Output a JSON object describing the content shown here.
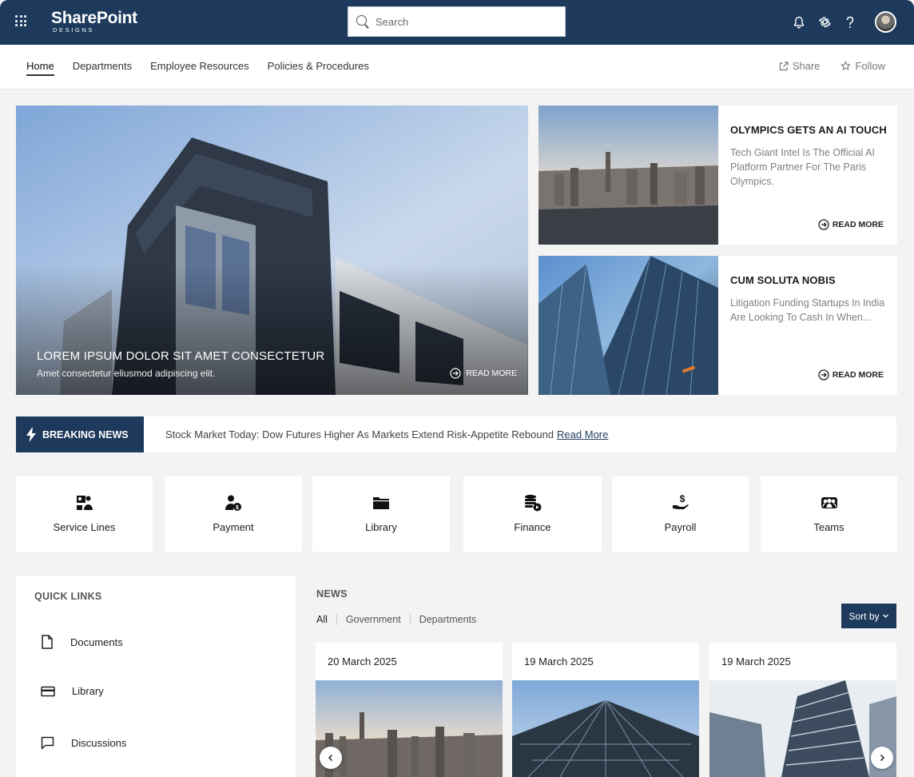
{
  "app": {
    "logo_main": "SharePoint",
    "logo_sub": "DESIGNS",
    "search_placeholder": "Search"
  },
  "nav": {
    "items": [
      "Home",
      "Departments",
      "Employee Resources",
      "Policies & Procedures"
    ],
    "active": "Home",
    "share_label": "Share",
    "follow_label": "Follow"
  },
  "hero": {
    "title": "LOREM IPSUM DOLOR SIT AMET CONSECTETUR",
    "subtitle": "Amet consectetur eliusmod adipiscing elit.",
    "read_more": "READ MORE"
  },
  "stories": [
    {
      "title": "OLYMPICS GETS AN AI TOUCH",
      "text": "Tech Giant Intel Is The Official AI Platform Partner For The Paris Olympics.",
      "read_more": "READ MORE"
    },
    {
      "title": "CUM SOLUTA NOBIS",
      "text": "Litigation Funding Startups In India Are Looking To Cash In When...",
      "read_more": "READ MORE"
    }
  ],
  "breaking": {
    "label": "BREAKING NEWS",
    "text": "Stock Market Today: Dow Futures Higher As Markets Extend Risk-Appetite Rebound",
    "link": "Read More"
  },
  "tiles": [
    {
      "label": "Service Lines",
      "icon": "service-lines-icon"
    },
    {
      "label": "Payment",
      "icon": "payment-icon"
    },
    {
      "label": "Library",
      "icon": "folder-icon"
    },
    {
      "label": "Finance",
      "icon": "coins-icon"
    },
    {
      "label": "Payroll",
      "icon": "hand-dollar-icon"
    },
    {
      "label": "Teams",
      "icon": "team-icon"
    }
  ],
  "quick_links": {
    "title": "QUICK LINKS",
    "items": [
      "Documents",
      "Library",
      "Discussions"
    ]
  },
  "news": {
    "title": "NEWS",
    "filters": [
      "All",
      "Government",
      "Departments"
    ],
    "sort_label": "Sort by",
    "cards": [
      {
        "date": "20 March 2025"
      },
      {
        "date": "19 March 2025"
      },
      {
        "date": "19 March 2025"
      }
    ]
  },
  "colors": {
    "brand_navy": "#1d3a5c",
    "page_bg": "#f3f3f4"
  }
}
